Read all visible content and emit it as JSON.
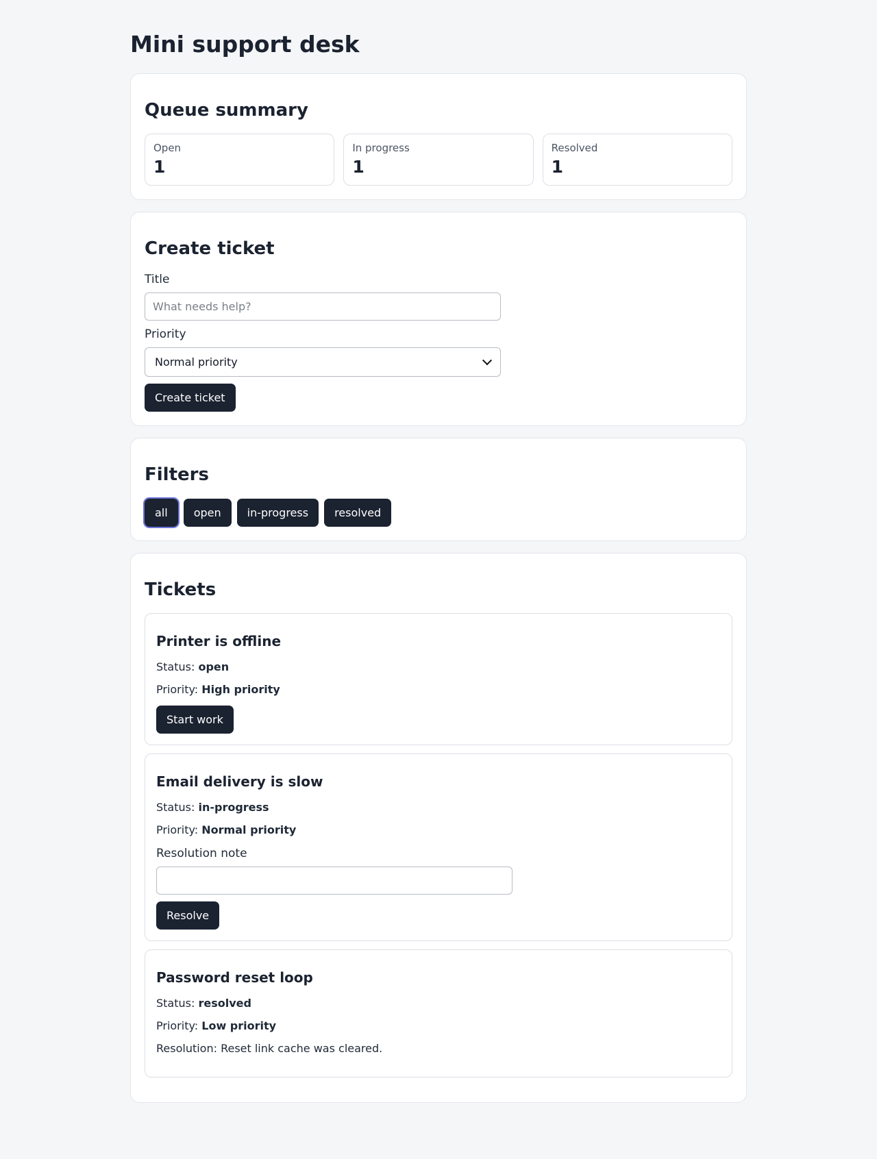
{
  "page": {
    "title": "Mini support desk"
  },
  "summary": {
    "heading": "Queue summary",
    "stats": [
      {
        "label": "Open",
        "value": "1"
      },
      {
        "label": "In progress",
        "value": "1"
      },
      {
        "label": "Resolved",
        "value": "1"
      }
    ]
  },
  "create": {
    "heading": "Create ticket",
    "title_label": "Title",
    "title_placeholder": "What needs help?",
    "title_value": "",
    "priority_label": "Priority",
    "priority_value": "Normal priority",
    "submit_label": "Create ticket"
  },
  "filters": {
    "heading": "Filters",
    "options": [
      "all",
      "open",
      "in-progress",
      "resolved"
    ],
    "active": "all"
  },
  "tickets": {
    "heading": "Tickets",
    "status_prefix": "Status:",
    "priority_prefix": "Priority:",
    "items": [
      {
        "title": "Printer is offline",
        "status": "open",
        "priority": "High priority",
        "action_label": "Start work"
      },
      {
        "title": "Email delivery is slow",
        "status": "in-progress",
        "priority": "Normal priority",
        "note_label": "Resolution note",
        "note_value": "",
        "action_label": "Resolve"
      },
      {
        "title": "Password reset loop",
        "status": "resolved",
        "priority": "Low priority",
        "resolution_text": "Resolution: Reset link cache was cleared."
      }
    ]
  },
  "colors": {
    "background": "#f5f6f8",
    "button": "#1b2230",
    "focus_ring": "#6a74d8"
  }
}
